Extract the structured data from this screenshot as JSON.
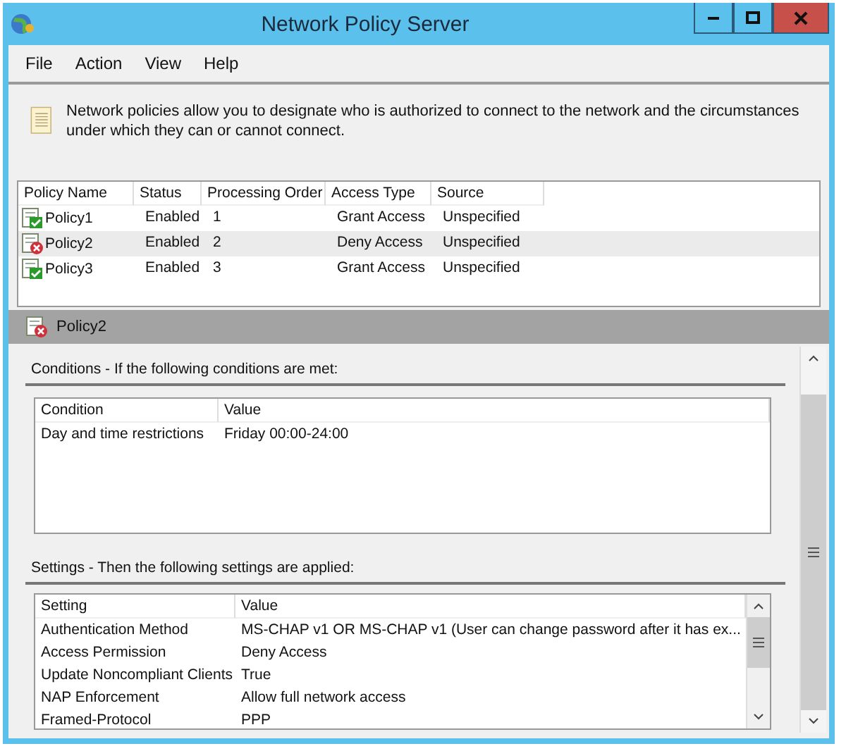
{
  "window": {
    "title": "Network Policy Server"
  },
  "menu": [
    "File",
    "Action",
    "View",
    "Help"
  ],
  "info": {
    "text": "Network policies allow you to designate who is authorized to connect to the network and the circumstances under which they can or cannot connect."
  },
  "policies": {
    "columns": [
      "Policy Name",
      "Status",
      "Processing Order",
      "Access Type",
      "Source"
    ],
    "rows": [
      {
        "kind": "grant",
        "selected": false,
        "cells": [
          "Policy1",
          "Enabled",
          "1",
          "Grant Access",
          "Unspecified"
        ]
      },
      {
        "kind": "deny",
        "selected": true,
        "cells": [
          "Policy2",
          "Enabled",
          "2",
          "Deny Access",
          "Unspecified"
        ]
      },
      {
        "kind": "grant",
        "selected": false,
        "cells": [
          "Policy3",
          "Enabled",
          "3",
          "Grant Access",
          "Unspecified"
        ]
      }
    ]
  },
  "detail": {
    "kind": "deny",
    "title": "Policy2"
  },
  "conditions": {
    "heading": "Conditions - If the following conditions are met:",
    "columns": [
      "Condition",
      "Value"
    ],
    "rows": [
      [
        "Day and time restrictions",
        "Friday 00:00-24:00"
      ]
    ]
  },
  "settings": {
    "heading": "Settings - Then the following settings are applied:",
    "columns": [
      "Setting",
      "Value"
    ],
    "rows": [
      [
        "Authentication Method",
        "MS-CHAP v1 OR MS-CHAP v1 (User can change password after it has ex..."
      ],
      [
        "Access Permission",
        "Deny Access"
      ],
      [
        "Update Noncompliant Clients",
        "True"
      ],
      [
        "NAP Enforcement",
        "Allow full network access"
      ],
      [
        "Framed-Protocol",
        "PPP"
      ]
    ]
  }
}
